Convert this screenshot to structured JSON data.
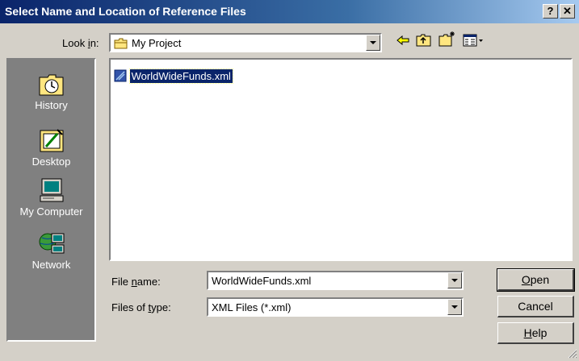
{
  "title": "Select Name and Location of Reference Files",
  "titlebar_buttons": {
    "help": "?",
    "close": "✕"
  },
  "look_in": {
    "label_pre": "Look ",
    "label_u": "i",
    "label_post": "n:",
    "value": "My Project"
  },
  "toolbar": [
    "back-icon",
    "up-folder-icon",
    "new-folder-icon",
    "view-menu-icon"
  ],
  "places": [
    {
      "id": "history",
      "label": "History",
      "icon": "history-icon"
    },
    {
      "id": "desktop",
      "label": "Desktop",
      "icon": "desktop-icon"
    },
    {
      "id": "my-computer",
      "label": "My Computer",
      "icon": "my-computer-icon"
    },
    {
      "id": "network",
      "label": "Network",
      "icon": "network-icon"
    }
  ],
  "files": [
    {
      "name": "WorldWideFunds.xml",
      "icon": "xml-file-icon",
      "selected": true
    }
  ],
  "file_name": {
    "label_pre": "File ",
    "label_u": "n",
    "label_post": "ame:",
    "value": "WorldWideFunds.xml"
  },
  "file_type": {
    "label_pre": "Files of ",
    "label_u": "t",
    "label_post": "ype:",
    "value": "XML Files (*.xml)"
  },
  "buttons": {
    "open": {
      "u": "O",
      "rest": "pen"
    },
    "cancel": {
      "label": "Cancel"
    },
    "help": {
      "u": "H",
      "rest": "elp"
    }
  },
  "colors": {
    "titlebar": "#0a246a",
    "dialog": "#d4d0c8",
    "places": "#808080",
    "selection": "#0a246a"
  }
}
